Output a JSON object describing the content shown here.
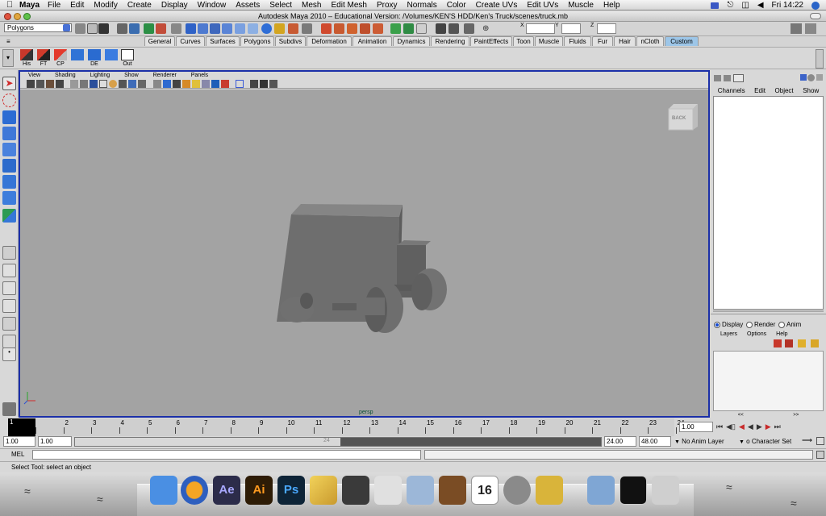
{
  "menubar": {
    "app": "Maya",
    "items": [
      "File",
      "Edit",
      "Modify",
      "Create",
      "Display",
      "Window",
      "Assets",
      "Select",
      "Mesh",
      "Edit Mesh",
      "Proxy",
      "Normals",
      "Color",
      "Create UVs",
      "Edit UVs",
      "Muscle",
      "Help"
    ],
    "clock": "Fri 14:22"
  },
  "window": {
    "title": "Autodesk Maya 2010 – Educational Version: /Volumes/KEN'S HDD/Ken's Truck/scenes/truck.mb"
  },
  "statusline": {
    "menuset": "Polygons",
    "x_label": "X",
    "y_label": "Y",
    "z_label": "Z"
  },
  "shelf": {
    "tabs": [
      "General",
      "Curves",
      "Surfaces",
      "Polygons",
      "Subdivs",
      "Deformation",
      "Animation",
      "Dynamics",
      "Rendering",
      "PaintEffects",
      "Toon",
      "Muscle",
      "Fluids",
      "Fur",
      "Hair",
      "nCloth",
      "Custom"
    ],
    "active_tab": "Custom",
    "buttons": [
      "His",
      "FT",
      "CP",
      "",
      "DE",
      "Out"
    ]
  },
  "viewpanel": {
    "menus": [
      "View",
      "Shading",
      "Lighting",
      "Show",
      "Renderer",
      "Panels"
    ],
    "camera": "persp",
    "viewcube": "BACK"
  },
  "channelbox": {
    "menus": [
      "Channels",
      "Edit",
      "Object",
      "Show"
    ]
  },
  "layers": {
    "modes": [
      "Display",
      "Render",
      "Anim"
    ],
    "active_mode": "Display",
    "menus": [
      "Layers",
      "Options",
      "Help"
    ],
    "scroll_left": "<<",
    "scroll_right": ">>"
  },
  "timeslider": {
    "ticks": [
      "1",
      "2",
      "3",
      "4",
      "5",
      "6",
      "7",
      "8",
      "9",
      "10",
      "11",
      "12",
      "13",
      "14",
      "15",
      "16",
      "17",
      "18",
      "19",
      "20",
      "21",
      "22",
      "23",
      "24"
    ],
    "current_frame": "1.00",
    "current_marker": "1",
    "range_marker": "24"
  },
  "rangeslider": {
    "start": "1.00",
    "anim_start": "1.00",
    "anim_end": "24.00",
    "end": "48.00",
    "anim_layer": "No Anim Layer",
    "character_set": "o Character Set"
  },
  "cmdline": {
    "label": "MEL"
  },
  "helpline": {
    "text": "Select Tool: select an object"
  },
  "dock": [
    "Finder",
    "Firefox",
    "Ae",
    "Ai",
    "Ps",
    "Pencil",
    "Maya",
    "Preview",
    "iPhoto",
    "GarageBand",
    "16",
    "System Preferences",
    "Keychain",
    "Folder",
    "Screen",
    "Trash"
  ],
  "colors": {
    "viewport_bg": "#a3a3a3",
    "panel_border": "#1b2fa8",
    "active_tab": "#9dc6e8"
  }
}
